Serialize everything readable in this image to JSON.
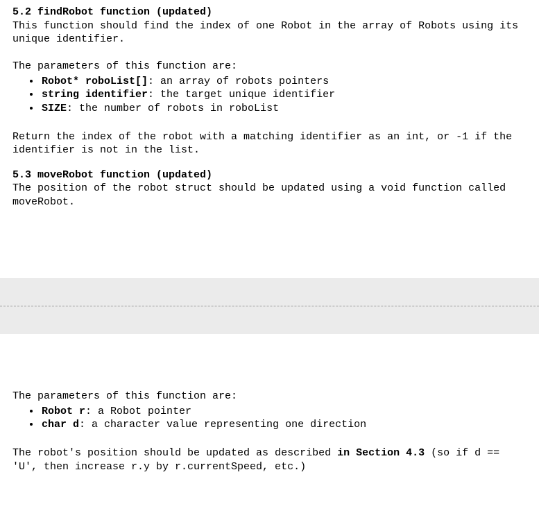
{
  "s52": {
    "heading": "5.2 findRobot function (updated)",
    "intro": "This function should find the index of one Robot in the array of Robots using its unique identifier.",
    "params_lead": "The parameters of this function are:",
    "params": [
      {
        "bold": "Robot* roboList[]",
        "rest": ": an array of robots pointers"
      },
      {
        "bold": "string identifier",
        "rest": ": the target unique identifier"
      },
      {
        "bold": "SIZE",
        "rest": ": the number of robots in roboList"
      }
    ],
    "return": "Return the index of the robot with a matching identifier as an int, or -1 if the identifier is not in the list."
  },
  "s53": {
    "heading": "5.3 moveRobot function (updated)",
    "intro": "The position of the robot struct should be updated using a void function called moveRobot.",
    "params_lead": "The parameters of this function are:",
    "params": [
      {
        "bold": "Robot r",
        "rest": ": a Robot pointer"
      },
      {
        "bold": "char d",
        "rest": ": a character value representing one direction"
      }
    ],
    "closing_pre": "The robot's position should be updated as described ",
    "closing_bold": "in Section 4.3",
    "closing_post": " (so if d == 'U', then increase r.y by r.currentSpeed, etc.)"
  }
}
